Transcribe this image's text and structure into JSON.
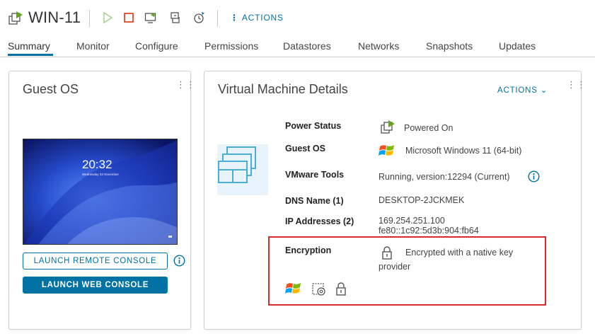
{
  "header": {
    "vm_name": "WIN-11",
    "actions_label": "ACTIONS",
    "toolbar_icons": [
      "power-on-icon",
      "power-off-icon",
      "launch-console-icon",
      "migrate-icon",
      "snapshot-icon"
    ]
  },
  "tabs": [
    {
      "label": "Summary",
      "active": true
    },
    {
      "label": "Monitor"
    },
    {
      "label": "Configure"
    },
    {
      "label": "Permissions"
    },
    {
      "label": "Datastores"
    },
    {
      "label": "Networks"
    },
    {
      "label": "Snapshots"
    },
    {
      "label": "Updates"
    }
  ],
  "guest_os_card": {
    "title": "Guest OS",
    "console_time": "20:32",
    "console_date": "Wednesday 23 November",
    "launch_remote_label": "LAUNCH REMOTE CONSOLE",
    "launch_web_label": "LAUNCH WEB CONSOLE"
  },
  "vm_details_card": {
    "title": "Virtual Machine Details",
    "actions_label": "ACTIONS",
    "rows": {
      "power_status": {
        "label": "Power Status",
        "value": "Powered On"
      },
      "guest_os": {
        "label": "Guest OS",
        "value": "Microsoft Windows 11 (64-bit)"
      },
      "vmware_tools": {
        "label": "VMware Tools",
        "value": "Running, version:12294 (Current)"
      },
      "dns_name": {
        "label": "DNS Name (1)",
        "value": "DESKTOP-2JCKMEK"
      },
      "ip_addresses": {
        "label": "IP Addresses (2)",
        "value_1": "169.254.251.100",
        "value_2": "fe80::1c92:5d3b:904:fb64"
      },
      "encryption": {
        "label": "Encryption",
        "value_line1": "Encrypted with a native key",
        "value_line2": "provider"
      }
    }
  },
  "colors": {
    "accent": "#0072a3",
    "highlight_box": "#d72b2b",
    "power_on_green": "#62a420",
    "power_off_red": "#e12200"
  }
}
